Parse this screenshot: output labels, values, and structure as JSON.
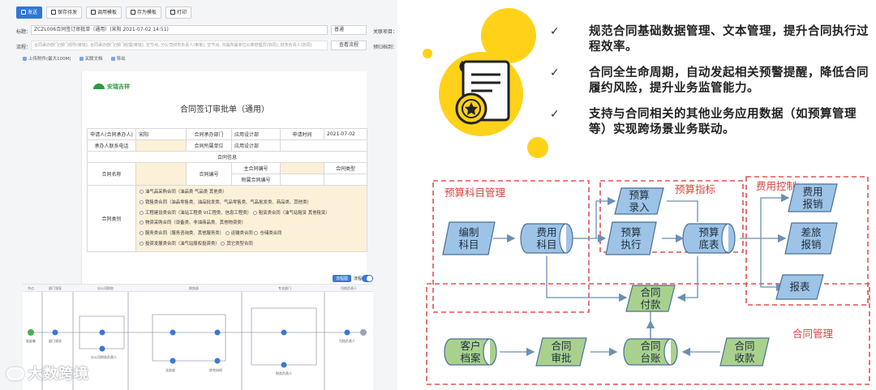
{
  "toolbar": {
    "send": "发送",
    "save_draft": "保存待发",
    "call_template": "调用模板",
    "save_template": "存为模板",
    "print": "打印"
  },
  "form_header": {
    "title_label": "标题：",
    "title_value": "ZCZL006合同签订审批单（通用）(宋阳 2021-07-02 14:51)",
    "priority_value": "普通",
    "related_project": "关联项目：",
    "flow_label": "流程：",
    "flow_value": "合同承办部门(部门领导(审批), 合同承办部门(部门经理(审批), 空节点, 分公司财务负责人(审批), 空节点, 归属所属单位公章管理员(协同), 财务负责人(协同)",
    "view_flow": "查看流程",
    "prev_files": "预归档到：",
    "upload": "上传附件(最大100M)",
    "related_doc": "关联文档",
    "export": "导出"
  },
  "document": {
    "logo_text": "安瑞吉祥",
    "title": "合同签订审批单（通用）",
    "applicant_label": "申请人(合同承办人)",
    "applicant_value": "宋阳",
    "dept_label": "合同承办部门",
    "dept_value": "应用设计部",
    "apply_time_label": "申请时间",
    "apply_time_value": "2021-07-02",
    "contact_label": "承办人联系电话",
    "unit_label": "合同所属单位",
    "unit_value": "应用设计部",
    "contract_info": "合同信息",
    "contract_name": "合同名称",
    "contract_no": "合同编号",
    "main_no": "主合同编号",
    "contract_type": "合同类型",
    "sub_no": "附属合同编号",
    "category": "合同类别",
    "types": [
      "油气品采购合同（油品类 气品类 其他类）",
      "销售类合同（油品零售类、油品批发类、气品零售类、气品批发类、商品类、其他类）",
      "工程建设类合同（油站工程类 VI工程类、信息工程类）",
      "租赁类合同（油气站租赁 其他租赁）",
      "物资采购合同（设备类、非油商品类、其他物资类）",
      "服务类合同（服务咨询类、其他服务类）",
      "运输类合同",
      "仓储类合同",
      "投资发展类合同（油气站股权投资类）",
      "其它类型合同"
    ]
  },
  "workflow": {
    "lanes": [
      "节点",
      "部门领导",
      "分公司财务",
      "",
      "财务部",
      "",
      "专业部门",
      "",
      "归档负责人"
    ],
    "toggle_label": "流程图",
    "view_label": "流程",
    "nodes": [
      "发起者",
      "部门领导",
      "分公司财务负责人",
      "法务部",
      "综合协同",
      "财务负责人",
      "归档负责人"
    ]
  },
  "watermark": "大数跨境",
  "bullets": [
    "规范合同基础数据管理、文本管理，提升合同执行过程效率。",
    "合同全生命周期，自动发起相关预警提醒，降低合同履约风险，提升业务监管能力。",
    "支持与合同相关的其他业务应用数据（如预算管理等）实现跨场景业务联动。"
  ],
  "check_mark": "✓",
  "diagram": {
    "groups": {
      "budget_subject": "预算科目管理",
      "budget_index": "预算指标",
      "expense": "费用控制",
      "contract": "合同管理"
    },
    "nodes": {
      "compile_subject": [
        "编制",
        "科目"
      ],
      "expense_subject": [
        "费用",
        "科目"
      ],
      "budget_entry": [
        "预算",
        "录入"
      ],
      "budget_exec": [
        "预算",
        "执行"
      ],
      "budget_base": [
        "预算",
        "底表"
      ],
      "expense_claim": [
        "费用",
        "报销"
      ],
      "travel_claim": [
        "差旅",
        "报销"
      ],
      "report": [
        "报表"
      ],
      "contract_pay": [
        "合同",
        "付款"
      ],
      "customer_file": [
        "客户",
        "档案"
      ],
      "contract_approve": [
        "合同",
        "审批"
      ],
      "contract_ledger": [
        "合同",
        "台账"
      ],
      "contract_receive": [
        "合同",
        "收款"
      ]
    },
    "colors": {
      "blue_fill": "#9dc3e6",
      "green_fill": "#a9d18e",
      "stroke": "#4a6f96",
      "dash_red": "#e05252"
    }
  }
}
